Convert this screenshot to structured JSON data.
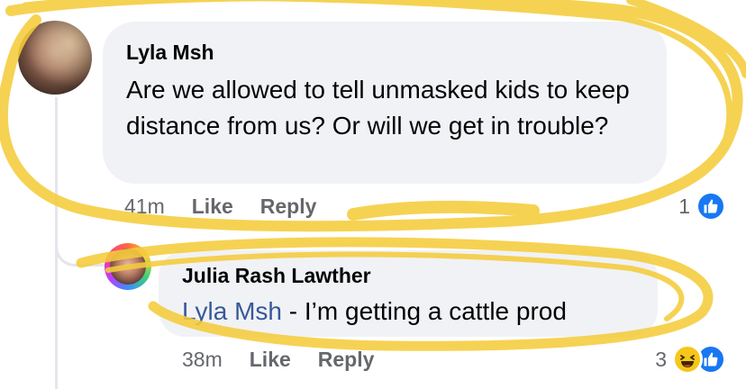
{
  "comments": [
    {
      "author": "Lyla Msh",
      "text": "Are we allowed to tell unmasked kids to keep distance from us? Or will we get in trouble?",
      "time": "41m",
      "like_label": "Like",
      "reply_label": "Reply",
      "reaction_count": "1",
      "reactions": [
        "like-icon"
      ]
    },
    {
      "author": "Julia Rash Lawther",
      "mention": "Lyla Msh",
      "text": " - I’m getting a cattle prod",
      "time": "38m",
      "like_label": "Like",
      "reply_label": "Reply",
      "reaction_count": "3",
      "reactions": [
        "haha-icon",
        "like-icon"
      ]
    }
  ],
  "colors": {
    "bubble_bg": "#f0f2f5",
    "meta_text": "#65676b",
    "mention": "#385898",
    "like_blue": "#1877f2",
    "haha_yellow": "#f7c61a",
    "highlighter": "#f5cc3c"
  }
}
